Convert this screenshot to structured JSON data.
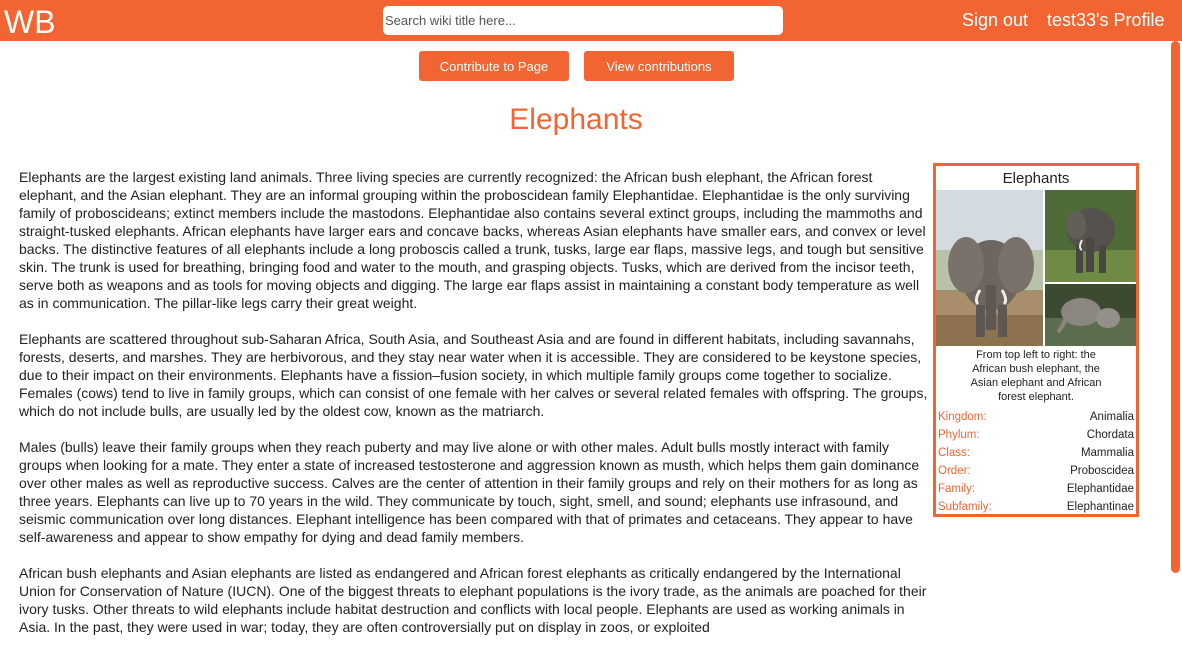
{
  "header": {
    "logo_text": "WB",
    "search_placeholder": "Search wiki title here...",
    "signout_label": "Sign out",
    "profile_label": "test33's Profile"
  },
  "actions": {
    "contribute_label": "Contribute to Page",
    "view_label": "View contributions"
  },
  "page": {
    "title": "Elephants"
  },
  "article": {
    "paragraphs": [
      "Elephants are the largest existing land animals. Three living species are currently recognized: the African bush elephant, the African forest elephant, and the Asian elephant. They are an informal grouping within the proboscidean family Elephantidae. Elephantidae is the only surviving family of proboscideans; extinct members include the mastodons. Elephantidae also contains several extinct groups, including the mammoths and straight-tusked elephants. African elephants have larger ears and concave backs, whereas Asian elephants have smaller ears, and convex or level backs. The distinctive features of all elephants include a long proboscis called a trunk, tusks, large ear flaps, massive legs, and tough but sensitive skin. The trunk is used for breathing, bringing food and water to the mouth, and grasping objects. Tusks, which are derived from the incisor teeth, serve both as weapons and as tools for moving objects and digging. The large ear flaps assist in maintaining a constant body temperature as well as in communication. The pillar-like legs carry their great weight.",
      "Elephants are scattered throughout sub-Saharan Africa, South Asia, and Southeast Asia and are found in different habitats, including savannahs, forests, deserts, and marshes. They are herbivorous, and they stay near water when it is accessible. They are considered to be keystone species, due to their impact on their environments. Elephants have a fission–fusion society, in which multiple family groups come together to socialize. Females (cows) tend to live in family groups, which can consist of one female with her calves or several related females with offspring. The groups, which do not include bulls, are usually led by the oldest cow, known as the matriarch.",
      "Males (bulls) leave their family groups when they reach puberty and may live alone or with other males. Adult bulls mostly interact with family groups when looking for a mate. They enter a state of increased testosterone and aggression known as musth, which helps them gain dominance over other males as well as reproductive success. Calves are the center of attention in their family groups and rely on their mothers for as long as three years. Elephants can live up to 70 years in the wild. They communicate by touch, sight, smell, and sound; elephants use infrasound, and seismic communication over long distances. Elephant intelligence has been compared with that of primates and cetaceans. They appear to have self-awareness and appear to show empathy for dying and dead family members.",
      "African bush elephants and Asian elephants are listed as endangered and African forest elephants as critically endangered by the International Union for Conservation of Nature (IUCN). One of the biggest threats to elephant populations is the ivory trade, as the animals are poached for their ivory tusks. Other threats to wild elephants include habitat destruction and conflicts with local people. Elephants are used as working animals in Asia. In the past, they were used in war; today, they are often controversially put on display in zoos, or exploited"
    ]
  },
  "infobox": {
    "title": "Elephants",
    "caption": "From top left to right: the African bush elephant, the Asian elephant and African forest elephant.",
    "taxonomy": [
      {
        "key": "Kingdom:",
        "value": "Animalia"
      },
      {
        "key": "Phylum:",
        "value": "Chordata"
      },
      {
        "key": "Class:",
        "value": "Mammalia"
      },
      {
        "key": "Order:",
        "value": "Proboscidea"
      },
      {
        "key": "Family:",
        "value": "Elephantidae"
      },
      {
        "key": "Subfamily:",
        "value": "Elephantinae"
      }
    ]
  },
  "colors": {
    "accent": "#f26532",
    "text": "#222222",
    "background": "#ffffff"
  }
}
